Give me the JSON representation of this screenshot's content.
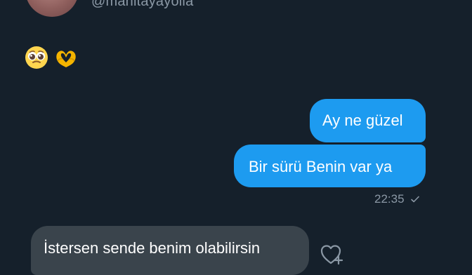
{
  "header": {
    "handle": "@manitayayolla"
  },
  "messages": {
    "emoji_message": [
      "pleading-face-emoji",
      "heart-hands-emoji"
    ],
    "sent_1": "Ay ne güzel",
    "sent_2": "Bir sürü Benin var ya",
    "sent_time": "22:35",
    "received_1": "İstersen sende benim olabilirsin"
  },
  "colors": {
    "background": "#15202b",
    "sent_bubble": "#1d9bf0",
    "received_bubble": "#3a444c",
    "muted_text": "#8b98a5"
  },
  "icons": {
    "status": "check-icon",
    "reaction": "heart-plus-icon"
  }
}
